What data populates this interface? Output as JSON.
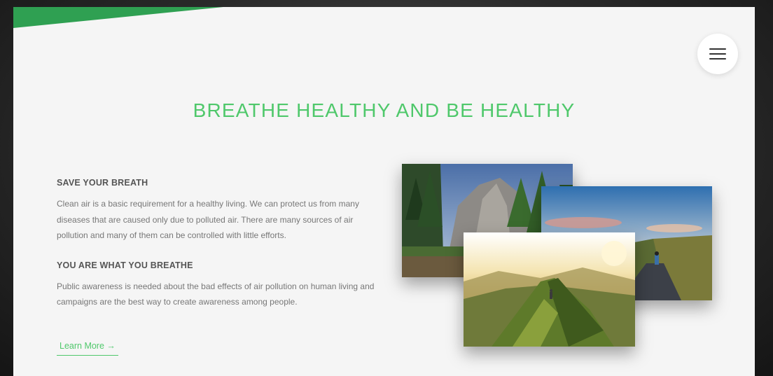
{
  "menu": {
    "icon": "hamburger-menu-icon"
  },
  "hero": {
    "title": "BREATHE HEALTHY AND BE HEALTHY"
  },
  "sections": [
    {
      "heading": "SAVE YOUR BREATH",
      "text": "Clean air is a basic requirement for a healthy living. We can protect us from many diseases that are caused only due to polluted air. There are many sources of air pollution and many of them can be controlled with little efforts."
    },
    {
      "heading": "YOU ARE WHAT YOU BREATHE",
      "text": "Public awareness is needed about the bad effects of air pollution on human living and campaigns are the best way to create awareness among people."
    }
  ],
  "cta": {
    "label": "Learn More →"
  },
  "colors": {
    "accent": "#4fc86b",
    "accent_dark": "#2fa052",
    "page_bg": "#f5f5f5"
  }
}
